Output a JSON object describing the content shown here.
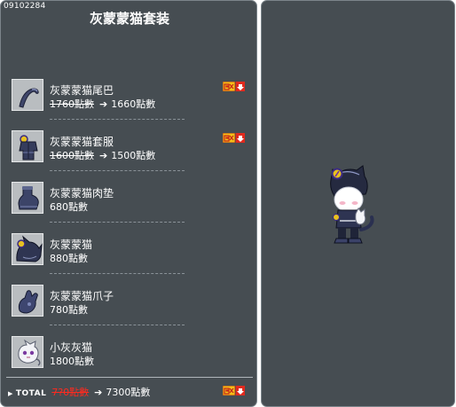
{
  "item_id": "09102284",
  "title": "灰蒙蒙猫套装",
  "arrow_glyph": "➔",
  "items": [
    {
      "name": "灰蒙蒙猫尾巴",
      "old_price": "1760點數",
      "price": "1660點數",
      "sale": true,
      "icon": "cat-tail-icon"
    },
    {
      "name": "灰蒙蒙猫套服",
      "old_price": "1600點數",
      "price": "1500點數",
      "sale": true,
      "icon": "cat-suit-icon"
    },
    {
      "name": "灰蒙蒙猫肉垫",
      "price": "680點數",
      "sale": false,
      "icon": "cat-paw-shoes-icon"
    },
    {
      "name": "灰蒙蒙猫",
      "price": "880點數",
      "sale": false,
      "icon": "cat-hat-icon"
    },
    {
      "name": "灰蒙蒙猫爪子",
      "price": "780點數",
      "sale": false,
      "icon": "cat-glove-icon"
    },
    {
      "name": "小灰灰猫",
      "price": "1800點數",
      "sale": false,
      "icon": "gray-kitten-pet-icon"
    }
  ],
  "total": {
    "label": "TOTAL",
    "old_price": "7?0點數",
    "price": "7300點數"
  },
  "colors": {
    "panel_bg": "#464d52",
    "sale_badge_bg": "#f3c218",
    "sale_arrow_red": "#e12a1e",
    "strike_red": "#ff2a1f"
  }
}
